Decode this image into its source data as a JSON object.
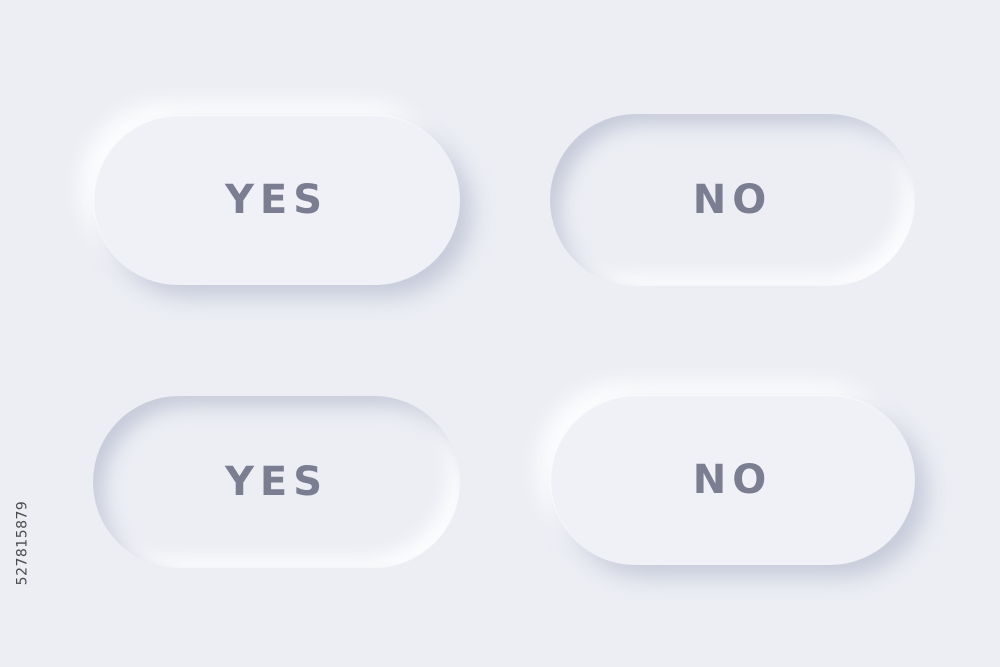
{
  "buttons": {
    "yes_top": {
      "label": "YES",
      "style": "raised"
    },
    "no_top": {
      "label": "NO",
      "style": "pressed"
    },
    "yes_bottom": {
      "label": "YES",
      "style": "pressed"
    },
    "no_bottom": {
      "label": "NO",
      "style": "raised"
    }
  },
  "stock_id": "527815879",
  "colors": {
    "background": "#eceef4",
    "label": "#7b7d91"
  }
}
